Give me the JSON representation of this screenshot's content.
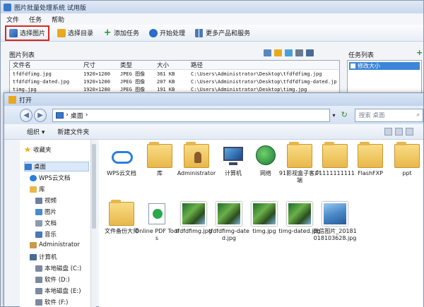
{
  "app": {
    "title": "图片批量处理系统 试用版",
    "menu": [
      "文件",
      "任务",
      "帮助"
    ],
    "toolbar": [
      {
        "label": "选择图片",
        "icon": "image-select-icon",
        "color": "#3a78c8",
        "highlighted": true
      },
      {
        "label": "选择目录",
        "icon": "folder-select-icon",
        "color": "#e8a91e"
      },
      {
        "label": "添加任务",
        "icon": "plus-icon",
        "color": "#1a9a2a"
      },
      {
        "label": "开始处理",
        "icon": "play-icon",
        "color": "#2a6cc8"
      },
      {
        "label": "更多产品和服务",
        "icon": "grid-icon",
        "color": "#4a7ab8"
      }
    ],
    "list_panel": {
      "label": "图片列表",
      "columns": [
        "文件名",
        "尺寸",
        "类型",
        "大小",
        "路径"
      ],
      "rows": [
        [
          "tfdfdfimg.jpg",
          "1920×1200",
          "JPEG 图像",
          "361 KB",
          "C:\\Users\\Administrator\\Desktop\\tfdfdfimg.jpg"
        ],
        [
          "tfdfdfimg-dated.jpg",
          "1920×1200",
          "JPEG 图像",
          "207 KB",
          "C:\\Users\\Administrator\\Desktop\\tfdfdfimg-dated.jpg"
        ],
        [
          "timg.jpg",
          "1920×1280",
          "JPEG 图像",
          "191 KB",
          "C:\\Users\\Administrator\\Desktop\\timg.jpg"
        ]
      ]
    },
    "task_panel": {
      "label": "任务列表",
      "items": [
        "修改大小"
      ]
    }
  },
  "dialog": {
    "title": "打开",
    "address": "桌面",
    "search_placeholder": "搜索 桌面",
    "commands": [
      "组织 ▾",
      "新建文件夹"
    ],
    "sidebar": [
      {
        "label": "收藏夹",
        "icon": "star-icon",
        "color": "#e8b020"
      },
      {
        "label": "桌面",
        "icon": "desktop-icon",
        "color": "#3a78c8",
        "selected": true
      },
      {
        "label": "WPS云文档",
        "icon": "cloud-icon",
        "color": "#2a7fd8"
      },
      {
        "label": "库",
        "icon": "library-icon",
        "color": "#e8b84a"
      },
      {
        "label": "视频",
        "icon": "video-icon",
        "color": "#6b7fa0"
      },
      {
        "label": "图片",
        "icon": "picture-icon",
        "color": "#4a8ac8"
      },
      {
        "label": "文档",
        "icon": "document-icon",
        "color": "#8a9ab0"
      },
      {
        "label": "音乐",
        "icon": "music-icon",
        "color": "#4a78b8"
      },
      {
        "label": "Administrator",
        "icon": "user-icon",
        "color": "#c89a4a"
      },
      {
        "label": "计算机",
        "icon": "computer-icon",
        "color": "#4a6a90"
      },
      {
        "label": "本地磁盘 (C:)",
        "icon": "disk-icon",
        "color": "#7a8aa0"
      },
      {
        "label": "软件 (D:)",
        "icon": "disk-icon",
        "color": "#7a8aa0"
      },
      {
        "label": "本地磁盘 (E:)",
        "icon": "disk-icon",
        "color": "#7a8aa0"
      },
      {
        "label": "软件 (F:)",
        "icon": "disk-icon",
        "color": "#7a8aa0"
      }
    ],
    "files": [
      {
        "label": "WPS云文档",
        "kind": "cloud"
      },
      {
        "label": "库",
        "kind": "folder"
      },
      {
        "label": "Administrator",
        "kind": "user"
      },
      {
        "label": "计算机",
        "kind": "computer"
      },
      {
        "label": "网络",
        "kind": "network"
      },
      {
        "label": "91影视盒子客户端",
        "kind": "folder"
      },
      {
        "label": "11111111111",
        "kind": "folder"
      },
      {
        "label": "FlashFXP",
        "kind": "folder"
      },
      {
        "label": "ppt",
        "kind": "folder"
      },
      {
        "label": "文件备份大师",
        "kind": "folder"
      },
      {
        "label": "Online PDF Tools",
        "kind": "app"
      },
      {
        "label": "tfdfdfimg.jpg",
        "kind": "photo"
      },
      {
        "label": "tfdfdfimg-dated.jpg",
        "kind": "photo"
      },
      {
        "label": "timg.jpg",
        "kind": "photo"
      },
      {
        "label": "timg-dated.jpg",
        "kind": "photo"
      },
      {
        "label": "微信图片_20181018103628.jpg",
        "kind": "photo2"
      }
    ]
  }
}
